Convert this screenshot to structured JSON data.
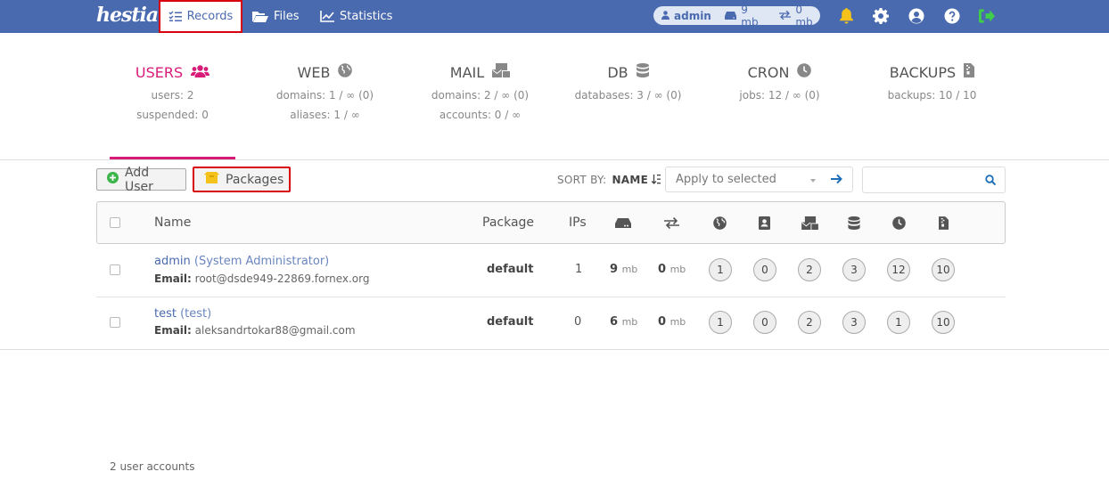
{
  "app": {
    "logo_text": "hestia"
  },
  "nav": {
    "records": "Records",
    "files": "Files",
    "statistics": "Statistics"
  },
  "user_pill": {
    "username": "admin",
    "disk": "9 mb",
    "bandwidth": "0 mb"
  },
  "stats": [
    {
      "title": "USERS",
      "line1": "users: 2",
      "line2": "suspended: 0",
      "icon": "users-icon"
    },
    {
      "title": "WEB",
      "line1": "domains: 1 / ∞ (0)",
      "line2": "aliases: 1 / ∞",
      "icon": "globe-icon"
    },
    {
      "title": "MAIL",
      "line1": "domains: 2 / ∞ (0)",
      "line2": "accounts: 0 / ∞",
      "icon": "mail-icon"
    },
    {
      "title": "DB",
      "line1": "databases: 3 / ∞ (0)",
      "line2": "",
      "icon": "database-icon"
    },
    {
      "title": "CRON",
      "line1": "jobs: 12 / ∞ (0)",
      "line2": "",
      "icon": "clock-icon"
    },
    {
      "title": "BACKUPS",
      "line1": "backups: 10 / 10",
      "line2": "",
      "icon": "file-archive-icon"
    }
  ],
  "toolbar": {
    "add_user": "Add User",
    "packages": "Packages",
    "sort_by": "SORT BY:",
    "sort_value": "NAME",
    "apply_placeholder": "Apply to selected",
    "search_value": ""
  },
  "table": {
    "headers": {
      "name": "Name",
      "package": "Package",
      "ips": "IPs"
    },
    "rows": [
      {
        "user": "admin",
        "fullname": "(System Administrator)",
        "email_label": "Email:",
        "email": "root@dsde949-22869.fornex.org",
        "package": "default",
        "ips": "1",
        "disk": "9",
        "disk_unit": "mb",
        "bandwidth": "0",
        "bw_unit": "mb",
        "web": "1",
        "dns": "0",
        "mail": "2",
        "db": "3",
        "cron": "12",
        "backups": "10"
      },
      {
        "user": "test",
        "fullname": "(test)",
        "email_label": "Email:",
        "email": "aleksandrtokar88@gmail.com",
        "package": "default",
        "ips": "0",
        "disk": "6",
        "disk_unit": "mb",
        "bandwidth": "0",
        "bw_unit": "mb",
        "web": "1",
        "dns": "0",
        "mail": "2",
        "db": "3",
        "cron": "1",
        "backups": "10"
      }
    ]
  },
  "footer": {
    "count": "2 user accounts"
  },
  "colors": {
    "topbar": "#4a6aaf",
    "accent": "#d81b78",
    "highlight": "#d9000d"
  }
}
